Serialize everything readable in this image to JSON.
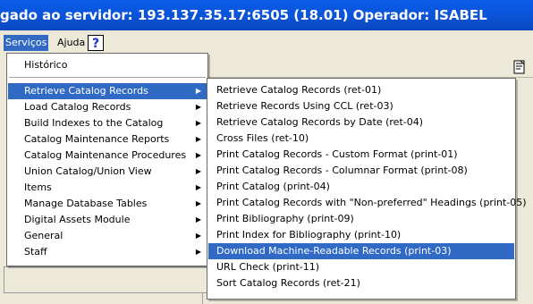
{
  "window": {
    "title": "gado ao servidor:  193.137.35.17:6505 (18.01)  Operador:  ISABEL"
  },
  "menubar": {
    "servicos": "Serviços",
    "ajuda": "Ajuda",
    "help_icon": "?"
  },
  "services_menu": {
    "top_item": "Histórico",
    "items": [
      "Retrieve Catalog Records",
      "Load Catalog Records",
      "Build Indexes to the Catalog",
      "Catalog Maintenance Reports",
      "Catalog Maintenance Procedures",
      "Union Catalog/Union View",
      "Items",
      "Manage Database Tables",
      "Digital Assets Module",
      "General",
      "Staff"
    ],
    "selected": "Retrieve Catalog Records"
  },
  "submenu": {
    "items": [
      "Retrieve Catalog Records (ret-01)",
      "Retrieve Records Using CCL (ret-03)",
      "Retrieve Catalog Records by Date (ret-04)",
      "Cross Files (ret-10)",
      "Print Catalog Records - Custom Format (print-01)",
      "Print Catalog Records - Columnar Format (print-08)",
      "Print Catalog (print-04)",
      "Print Catalog Records with \"Non-preferred\" Headings (print-05)",
      "Print Bibliography (print-09)",
      "Print Index for Bibliography (print-10)",
      "Download Machine-Readable Records (print-03)",
      "URL Check (print-11)",
      "Sort Catalog Records (ret-21)"
    ],
    "selected": "Download Machine-Readable Records (print-03)"
  },
  "colors": {
    "title_bar": "#0b53d6",
    "selection": "#316ac5",
    "menu_bg": "#ffffff",
    "window_bg": "#ece9d8"
  }
}
